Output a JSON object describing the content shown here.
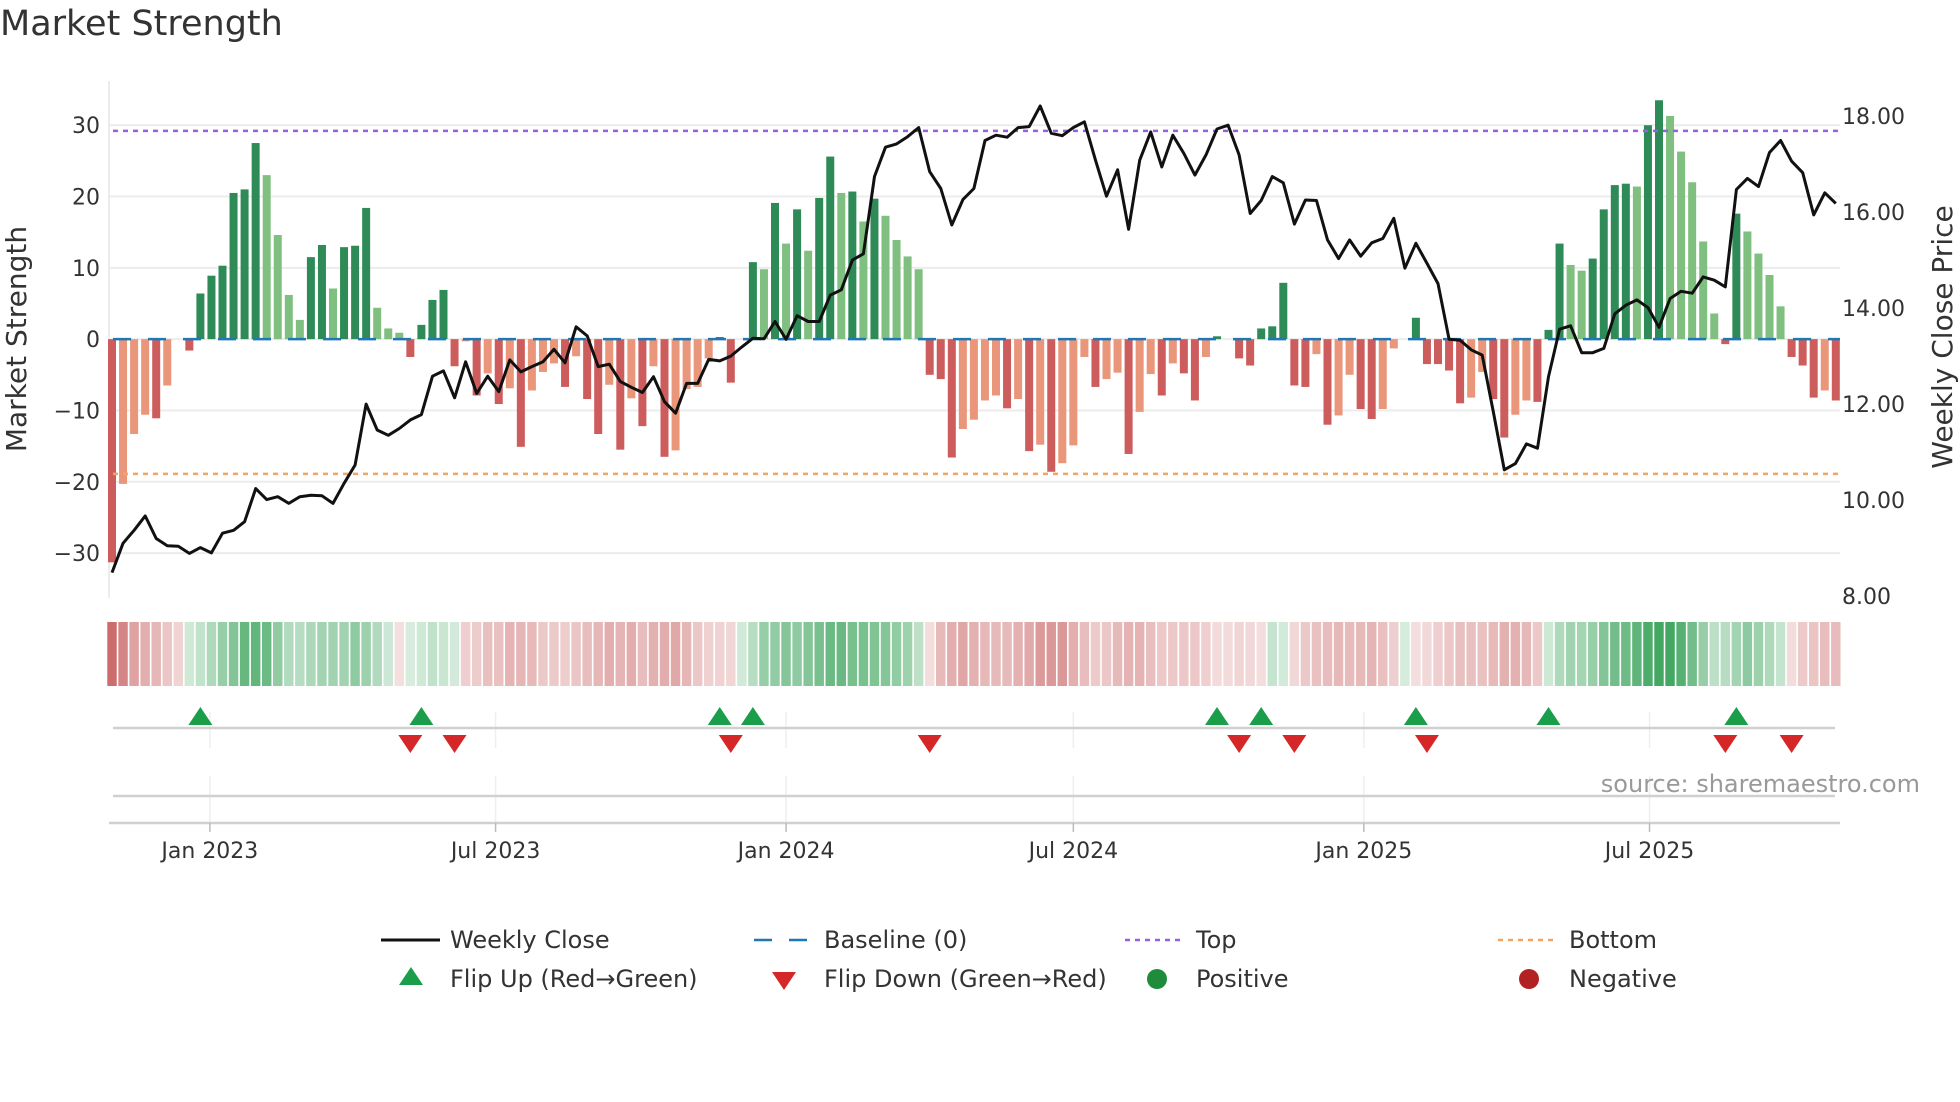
{
  "title": "Market Strength",
  "source": "source: sharemaestro.com",
  "legend": {
    "weekly_close": "Weekly Close",
    "baseline": "Baseline (0)",
    "top": "Top",
    "bottom": "Bottom",
    "flip_up": "Flip Up (Red→Green)",
    "flip_down": "Flip Down (Green→Red)",
    "positive": "Positive",
    "negative": "Negative"
  },
  "colors": {
    "strong_up": "#2e8b57",
    "weak_up": "#7fbf7f",
    "strong_down": "#cd5c5c",
    "weak_down": "#e9967a",
    "price_line": "#111111",
    "baseline": "#1f77b4",
    "top": "#9b5de5",
    "bottom": "#f4a460",
    "flip_up": "#1a9e4a",
    "flip_down": "#d62728",
    "positive": "#1e8c3a",
    "negative": "#b22222"
  },
  "chart_data": {
    "type": "bar",
    "title": "Market Strength",
    "ylabel": "Market Strength",
    "y2label": "Weekly Close Price",
    "x_start": "2022-10-31",
    "x_interval_days": 7,
    "ylim": [
      -36.3,
      36.2
    ],
    "y2lim": [
      7.96,
      18.73
    ],
    "yticks": [
      "−30",
      "−20",
      "−10",
      "0",
      "10",
      "20",
      "30"
    ],
    "ytick_values": [
      -30,
      -20,
      -10,
      0,
      10,
      20,
      30
    ],
    "y2ticks": [
      "8.00",
      "10.00",
      "12.00",
      "14.00",
      "16.00",
      "18.00"
    ],
    "y2tick_values": [
      8,
      10,
      12,
      14,
      16,
      18
    ],
    "xticks": [
      {
        "label": "Jan 2023",
        "date": "2023-01-01"
      },
      {
        "label": "Jul 2023",
        "date": "2023-07-01"
      },
      {
        "label": "Jan 2024",
        "date": "2024-01-01"
      },
      {
        "label": "Jul 2024",
        "date": "2024-07-01"
      },
      {
        "label": "Jan 2025",
        "date": "2025-01-01"
      },
      {
        "label": "Jul 2025",
        "date": "2025-07-01"
      }
    ],
    "top_level": 29.2,
    "bottom_level": -18.9,
    "baseline": 0,
    "grid": true,
    "legend_position": "bottom",
    "strength": [
      -31.3,
      -20.3,
      -13.3,
      -10.6,
      -11.1,
      -6.5,
      0,
      -1.6,
      6.4,
      8.9,
      10.3,
      20.5,
      21.0,
      27.5,
      23.0,
      14.6,
      6.2,
      2.7,
      11.5,
      13.2,
      7.1,
      12.9,
      13.1,
      18.4,
      4.4,
      1.5,
      0.9,
      -2.5,
      2.0,
      5.5,
      6.9,
      -3.8,
      -0.3,
      -7.9,
      -4.8,
      -9.1,
      -6.9,
      -15.1,
      -7.2,
      -4.6,
      -3.4,
      -6.7,
      -2.4,
      -8.4,
      -13.3,
      -6.4,
      -15.5,
      -8.3,
      -12.2,
      -3.8,
      -16.5,
      -15.6,
      -7.0,
      -6.7,
      -2.7,
      0.3,
      -6.1,
      0,
      10.8,
      9.8,
      19.1,
      13.4,
      18.2,
      12.4,
      19.8,
      25.6,
      20.5,
      20.7,
      16.5,
      19.7,
      17.3,
      13.9,
      11.6,
      9.8,
      -5.0,
      -5.6,
      -16.6,
      -12.6,
      -11.3,
      -8.6,
      -7.9,
      -9.7,
      -8.4,
      -15.7,
      -14.8,
      -18.6,
      -17.4,
      -14.9,
      -2.5,
      -6.7,
      -5.6,
      -4.7,
      -16.1,
      -10.2,
      -4.9,
      -7.9,
      -3.4,
      -4.8,
      -8.6,
      -2.5,
      0.4,
      0,
      -2.7,
      -3.7,
      1.5,
      1.8,
      7.9,
      -6.5,
      -6.7,
      -2.1,
      -12.0,
      -10.7,
      -5.0,
      -9.8,
      -11.2,
      -9.8,
      -1.3,
      0,
      3.0,
      -3.5,
      -3.5,
      -4.4,
      -9.0,
      -8.2,
      -4.6,
      -8.4,
      -13.8,
      -10.6,
      -8.6,
      -8.8,
      1.3,
      13.4,
      10.4,
      9.6,
      11.3,
      18.2,
      21.6,
      21.8,
      21.4,
      30.0,
      33.5,
      31.3,
      26.3,
      22.0,
      13.7,
      3.6,
      -0.7,
      17.6,
      15.1,
      12.0,
      9.0,
      4.6,
      -2.5,
      -3.7,
      -8.2,
      -7.2,
      -8.6
    ],
    "weekly_close": [
      8.49,
      9.1,
      9.37,
      9.67,
      9.2,
      9.05,
      9.04,
      8.89,
      9.01,
      8.9,
      9.31,
      9.37,
      9.55,
      10.24,
      10.01,
      10.07,
      9.93,
      10.07,
      10.1,
      10.09,
      9.93,
      10.35,
      10.73,
      12.0,
      11.46,
      11.35,
      11.49,
      11.67,
      11.78,
      12.58,
      12.69,
      12.13,
      12.88,
      12.22,
      12.58,
      12.26,
      12.92,
      12.67,
      12.78,
      12.88,
      13.14,
      12.86,
      13.61,
      13.42,
      12.78,
      12.83,
      12.47,
      12.35,
      12.24,
      12.57,
      12.05,
      11.81,
      12.43,
      12.43,
      12.93,
      12.9,
      13.0,
      13.19,
      13.37,
      13.36,
      13.72,
      13.35,
      13.84,
      13.72,
      13.72,
      14.27,
      14.38,
      15.0,
      15.13,
      16.74,
      17.35,
      17.42,
      17.57,
      17.76,
      16.84,
      16.49,
      15.73,
      16.26,
      16.49,
      17.49,
      17.6,
      17.56,
      17.76,
      17.78,
      18.21,
      17.64,
      17.59,
      17.76,
      17.88,
      17.08,
      16.33,
      16.88,
      15.64,
      17.08,
      17.67,
      16.94,
      17.6,
      17.22,
      16.77,
      17.19,
      17.73,
      17.81,
      17.19,
      15.97,
      16.24,
      16.74,
      16.61,
      15.75,
      16.25,
      16.24,
      15.42,
      15.03,
      15.42,
      15.08,
      15.36,
      15.45,
      15.87,
      14.83,
      15.35,
      14.93,
      14.51,
      13.35,
      13.33,
      13.13,
      13.02,
      11.84,
      10.63,
      10.76,
      11.17,
      11.08,
      12.57,
      13.56,
      13.63,
      13.07,
      13.07,
      13.16,
      13.88,
      14.06,
      14.17,
      14.01,
      13.6,
      14.2,
      14.35,
      14.31,
      14.65,
      14.58,
      14.44,
      16.47,
      16.7,
      16.53,
      17.24,
      17.49,
      17.06,
      16.82,
      15.94,
      16.4,
      16.18
    ],
    "flip_up_weeks": [
      9,
      29,
      56,
      59,
      101,
      105,
      119,
      131,
      148
    ],
    "flip_down_weeks": [
      28,
      32,
      57,
      75,
      103,
      108,
      120,
      147,
      153
    ]
  }
}
